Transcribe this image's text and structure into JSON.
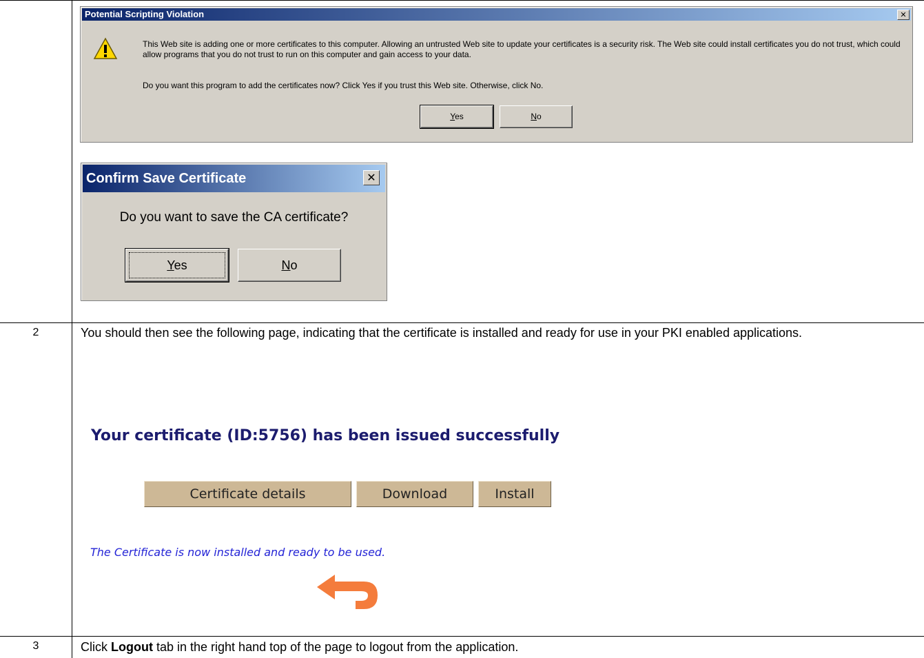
{
  "dialog1": {
    "title": "Potential Scripting Violation",
    "message": "This Web site is adding one or more certificates to this computer. Allowing an untrusted Web site to update your certificates is a security risk. The Web site could install certificates you do not trust, which could allow programs that you do not trust to run on this computer and gain access to your data.",
    "question": "Do you want this program to add the certificates now? Click Yes if you trust this Web site. Otherwise, click No.",
    "yes_label": "es",
    "yes_accel": "Y",
    "no_label": "o",
    "no_accel": "N",
    "close_glyph": "✕"
  },
  "dialog2": {
    "title": "Confirm Save Certificate",
    "message": "Do you want to save the CA certificate?",
    "yes_label": "es",
    "yes_accel": "Y",
    "no_label": "o",
    "no_accel": "N",
    "close_glyph": "✕"
  },
  "row2": {
    "number": "2",
    "text": "You should then see the following page, indicating that the certificate is installed and ready for use in your PKI enabled applications.",
    "page": {
      "heading": "Your certificate (ID:5756) has been issued successfully",
      "buttons": [
        "Certificate details",
        "Download",
        "Install"
      ],
      "status": "The Certificate is now installed and ready to be used.",
      "back_icon": "back-arrow-icon"
    }
  },
  "row3": {
    "number": "3",
    "text_before": "Click ",
    "text_bold": "Logout",
    "text_after": " tab in the right hand top of the page to logout from the application."
  },
  "colors": {
    "title_bar": "#0a246a",
    "dialog_bg": "#d4d0c8",
    "heading": "#1c1c6e",
    "status": "#2323d6",
    "arrow": "#f47c3c",
    "web_button": "#cdb896"
  }
}
